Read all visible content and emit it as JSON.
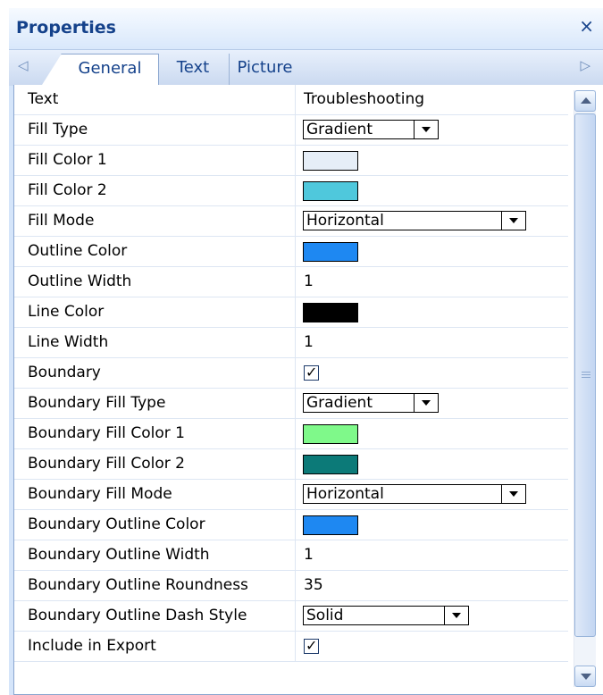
{
  "panel": {
    "title": "Properties",
    "close_icon": "×"
  },
  "tabs": {
    "left_arrow": "◁",
    "right_arrow": "▷",
    "items": [
      "General",
      "Text",
      "Picture"
    ],
    "active": "General"
  },
  "colors": {
    "fill_color_1": "#e6eef7",
    "fill_color_2": "#4fc8dc",
    "outline_color": "#1e88f2",
    "line_color": "#000000",
    "boundary_fill_color_1": "#7ff98a",
    "boundary_fill_color_2": "#0c7a78",
    "boundary_outline_color": "#1e88f2"
  },
  "rows": [
    {
      "name": "Text",
      "value": "Troubleshooting"
    },
    {
      "name": "Fill Type",
      "value": "Gradient"
    },
    {
      "name": "Fill Color 1"
    },
    {
      "name": "Fill Color 2"
    },
    {
      "name": "Fill Mode",
      "value": "Horizontal"
    },
    {
      "name": "Outline Color"
    },
    {
      "name": "Outline Width",
      "value": "1"
    },
    {
      "name": "Line Color"
    },
    {
      "name": "Line Width",
      "value": "1"
    },
    {
      "name": "Boundary",
      "checked": true
    },
    {
      "name": "Boundary Fill Type",
      "value": "Gradient"
    },
    {
      "name": "Boundary Fill Color 1"
    },
    {
      "name": "Boundary Fill Color 2"
    },
    {
      "name": "Boundary Fill Mode",
      "value": "Horizontal"
    },
    {
      "name": "Boundary Outline Color"
    },
    {
      "name": "Boundary Outline Width",
      "value": "1"
    },
    {
      "name": "Boundary Outline Roundness",
      "value": "35"
    },
    {
      "name": "Boundary Outline Dash Style",
      "value": "Solid"
    },
    {
      "name": "Include in Export",
      "checked": true
    }
  ]
}
